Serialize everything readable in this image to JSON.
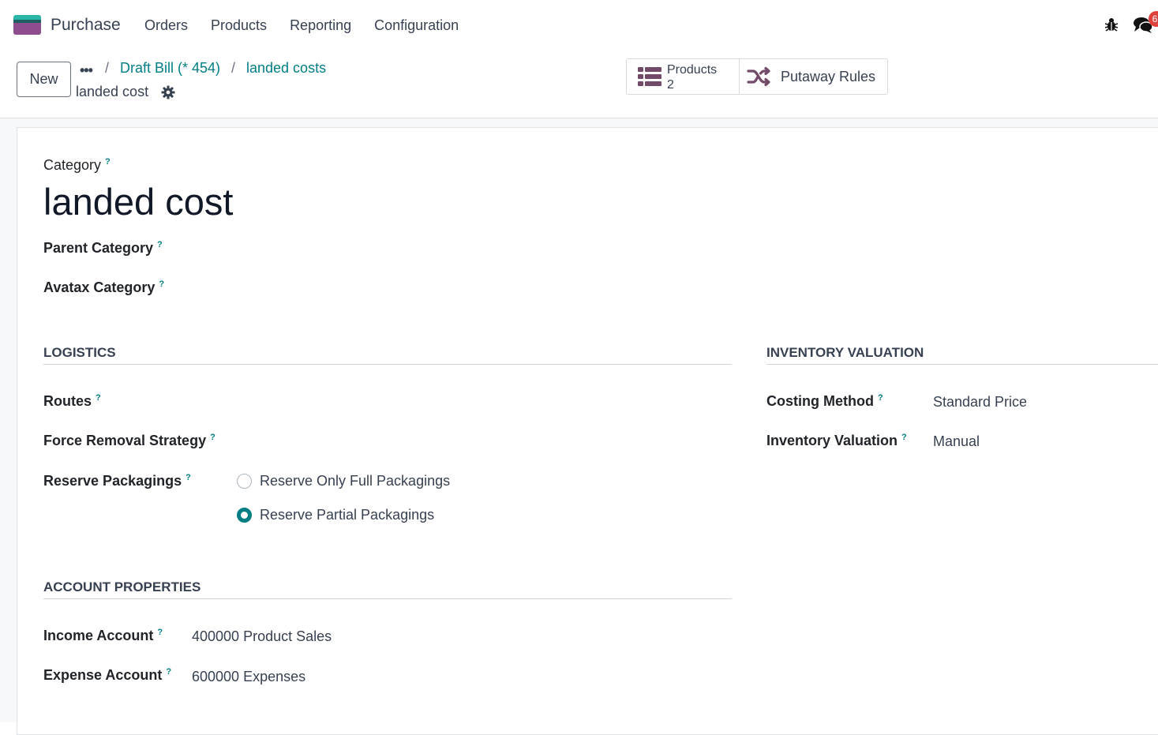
{
  "navbar": {
    "app_name": "Purchase",
    "menu": [
      "Orders",
      "Products",
      "Reporting",
      "Configuration"
    ],
    "chat_badge": "6"
  },
  "control": {
    "new_label": "New",
    "dots": "•••",
    "sep": "/",
    "crumbs": [
      "Draft Bill (* 454)",
      "landed costs"
    ],
    "record_name": "landed cost",
    "stat_products_label": "Products",
    "stat_products_value": "2",
    "putaway_label": "Putaway Rules"
  },
  "form": {
    "category_label": "Category",
    "help": "?",
    "title": "landed cost",
    "parent_category_label": "Parent Category",
    "avatax_category_label": "Avatax Category",
    "logistics": {
      "title": "LOGISTICS",
      "routes_label": "Routes",
      "force_removal_label": "Force Removal Strategy",
      "reserve_packagings_label": "Reserve Packagings",
      "options": [
        "Reserve Only Full Packagings",
        "Reserve Partial Packagings"
      ],
      "selected_index": 1
    },
    "inventory": {
      "title": "INVENTORY VALUATION",
      "costing_method_label": "Costing Method",
      "costing_method_value": "Standard Price",
      "inventory_valuation_label": "Inventory Valuation",
      "inventory_valuation_value": "Manual"
    },
    "accounts": {
      "title": "ACCOUNT PROPERTIES",
      "income_label": "Income Account",
      "income_value": "400000 Product Sales",
      "expense_label": "Expense Account",
      "expense_value": "600000 Expenses"
    }
  },
  "colors": {
    "accent": "#017e84",
    "brand_purple": "#714b67",
    "badge": "#e0413d"
  },
  "icons": [
    "app-logo",
    "bug-icon",
    "chat-icon",
    "gear-icon",
    "list-icon",
    "shuffle-icon"
  ]
}
